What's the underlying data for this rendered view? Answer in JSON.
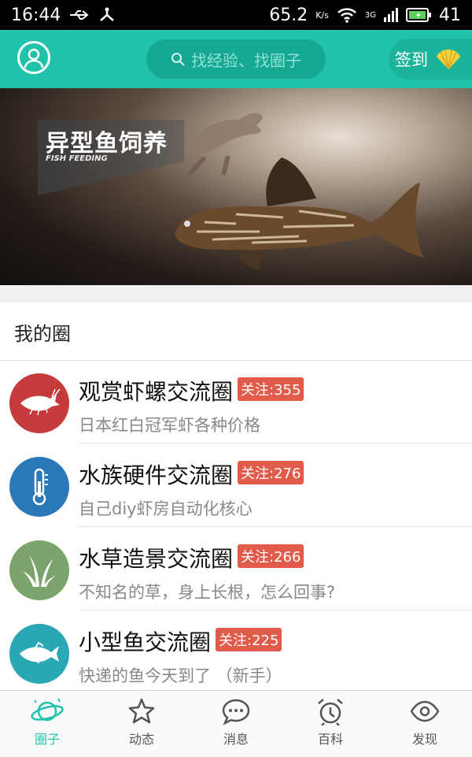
{
  "status_bar": {
    "time": "16:44",
    "speed": "65.2",
    "speed_unit": "K/s",
    "network": "3G",
    "battery": "41"
  },
  "header": {
    "search_placeholder": "找经验、找圈子",
    "signin_label": "签到"
  },
  "banner": {
    "title": "异型鱼饲养",
    "subtitle": "FISH FEEDING",
    "dot_count": 4,
    "active_dot": 2
  },
  "my_circles": {
    "title": "我的圈",
    "items": [
      {
        "name": "观赏虾螺交流圈",
        "follow": "关注:355",
        "desc": "日本红白冠军虾各种价格",
        "icon": "shrimp-icon",
        "color": "#c53a3a"
      },
      {
        "name": "水族硬件交流圈",
        "follow": "关注:276",
        "desc": "自己diy虾房自动化核心",
        "icon": "thermometer-icon",
        "color": "#2b78b8"
      },
      {
        "name": "水草造景交流圈",
        "follow": "关注:266",
        "desc": "不知名的草，身上长根，怎么回事?",
        "icon": "grass-icon",
        "color": "#7ca36b"
      },
      {
        "name": "小型鱼交流圈",
        "follow": "关注:225",
        "desc": "快递的鱼今天到了 （新手）",
        "icon": "fish-icon",
        "color": "#2aa7b5"
      }
    ]
  },
  "tabs": [
    {
      "label": "圈子",
      "icon": "planet-icon",
      "active": true
    },
    {
      "label": "动态",
      "icon": "star-icon",
      "active": false
    },
    {
      "label": "消息",
      "icon": "chat-icon",
      "active": false
    },
    {
      "label": "百科",
      "icon": "alarm-clock-icon",
      "active": false
    },
    {
      "label": "发现",
      "icon": "eye-icon",
      "active": false
    }
  ],
  "colors": {
    "accent": "#20c3aa",
    "badge": "#e15b4b"
  }
}
